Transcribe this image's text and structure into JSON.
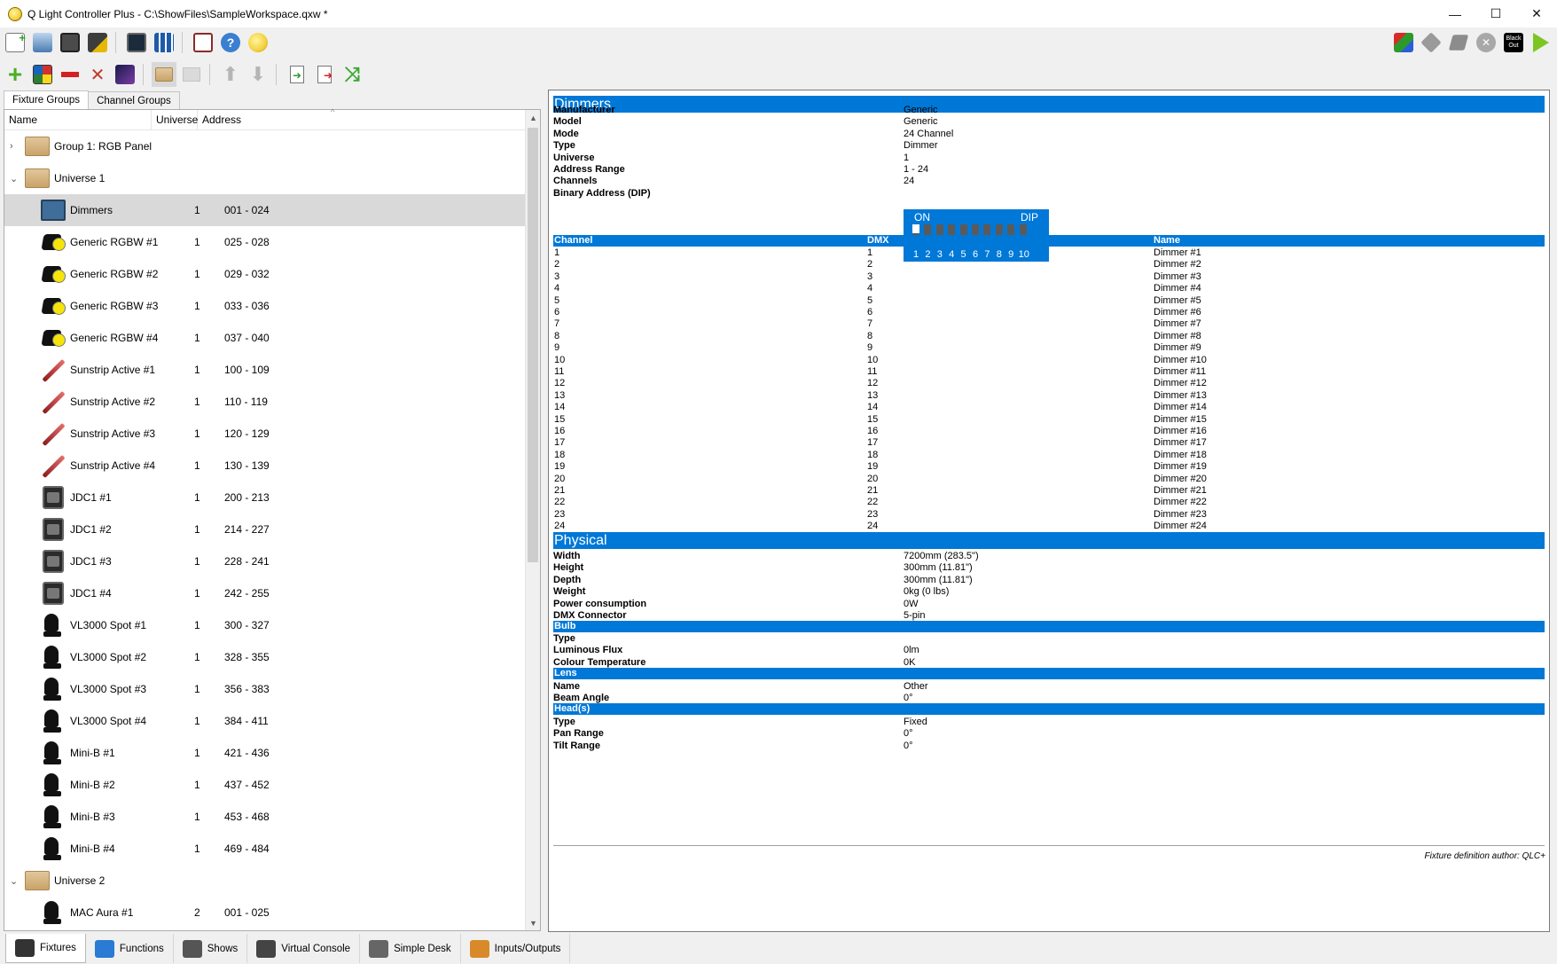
{
  "window": {
    "title": "Q Light Controller Plus - C:\\ShowFiles\\SampleWorkspace.qxw *",
    "minimize": "—",
    "maximize": "☐",
    "close": "✕"
  },
  "toolbar_top": {
    "icons": [
      "new-workspace-icon",
      "open-workspace-icon",
      "save-workspace-icon",
      "save-as-icon",
      "monitor-icon",
      "address-tool-icon",
      "fullscreen-icon",
      "help-icon",
      "about-icon"
    ],
    "right_icons": [
      "live-edit-icon",
      "stop-all-functions-icon",
      "kill-icon",
      "blackout-icon",
      "operate-mode-icon"
    ],
    "blackout_label": "Black Out"
  },
  "toolbar_fixtures": {
    "icons": [
      "add-fixture-icon",
      "add-rgb-panel-icon",
      "remove-fixture-icon",
      "configure-fixture-icon",
      "fade-config-icon",
      "group-fixture-icon",
      "ungroup-fixture-icon",
      "move-up-icon",
      "move-down-icon",
      "import-icon",
      "export-icon",
      "remap-icon"
    ]
  },
  "left_tabs": [
    {
      "label": "Fixture Groups",
      "active": true
    },
    {
      "label": "Channel Groups",
      "active": false
    }
  ],
  "tree": {
    "headers": {
      "name": "Name",
      "universe": "Universe",
      "address": "Address"
    },
    "rows": [
      {
        "type": "group",
        "level": 0,
        "expander": "›",
        "name": "Group 1: RGB Panel",
        "universe": "",
        "address": "",
        "icon": "folder-icon"
      },
      {
        "type": "universe",
        "level": 0,
        "expander": "⌄",
        "name": "Universe 1",
        "universe": "",
        "address": "",
        "icon": "folder-icon"
      },
      {
        "type": "fixture",
        "level": 1,
        "name": "Dimmers",
        "universe": "1",
        "address": "001 - 024",
        "icon": "dimmer-icon",
        "selected": true
      },
      {
        "type": "fixture",
        "level": 1,
        "name": "Generic RGBW #1",
        "universe": "1",
        "address": "025 - 028",
        "icon": "par-icon"
      },
      {
        "type": "fixture",
        "level": 1,
        "name": "Generic RGBW #2",
        "universe": "1",
        "address": "029 - 032",
        "icon": "par-icon"
      },
      {
        "type": "fixture",
        "level": 1,
        "name": "Generic RGBW #3",
        "universe": "1",
        "address": "033 - 036",
        "icon": "par-icon"
      },
      {
        "type": "fixture",
        "level": 1,
        "name": "Generic RGBW #4",
        "universe": "1",
        "address": "037 - 040",
        "icon": "par-icon"
      },
      {
        "type": "fixture",
        "level": 1,
        "name": "Sunstrip Active #1",
        "universe": "1",
        "address": "100 - 109",
        "icon": "strip-icon"
      },
      {
        "type": "fixture",
        "level": 1,
        "name": "Sunstrip Active #2",
        "universe": "1",
        "address": "110 - 119",
        "icon": "strip-icon"
      },
      {
        "type": "fixture",
        "level": 1,
        "name": "Sunstrip Active #3",
        "universe": "1",
        "address": "120 - 129",
        "icon": "strip-icon"
      },
      {
        "type": "fixture",
        "level": 1,
        "name": "Sunstrip Active #4",
        "universe": "1",
        "address": "130 - 139",
        "icon": "strip-icon"
      },
      {
        "type": "fixture",
        "level": 1,
        "name": "JDC1 #1",
        "universe": "1",
        "address": "200 - 213",
        "icon": "strobe-icon"
      },
      {
        "type": "fixture",
        "level": 1,
        "name": "JDC1 #2",
        "universe": "1",
        "address": "214 - 227",
        "icon": "strobe-icon"
      },
      {
        "type": "fixture",
        "level": 1,
        "name": "JDC1 #3",
        "universe": "1",
        "address": "228 - 241",
        "icon": "strobe-icon"
      },
      {
        "type": "fixture",
        "level": 1,
        "name": "JDC1 #4",
        "universe": "1",
        "address": "242 - 255",
        "icon": "strobe-icon"
      },
      {
        "type": "fixture",
        "level": 1,
        "name": "VL3000 Spot #1",
        "universe": "1",
        "address": "300 - 327",
        "icon": "moving-head-icon"
      },
      {
        "type": "fixture",
        "level": 1,
        "name": "VL3000 Spot #2",
        "universe": "1",
        "address": "328 - 355",
        "icon": "moving-head-icon"
      },
      {
        "type": "fixture",
        "level": 1,
        "name": "VL3000 Spot #3",
        "universe": "1",
        "address": "356 - 383",
        "icon": "moving-head-icon"
      },
      {
        "type": "fixture",
        "level": 1,
        "name": "VL3000 Spot #4",
        "universe": "1",
        "address": "384 - 411",
        "icon": "moving-head-icon"
      },
      {
        "type": "fixture",
        "level": 1,
        "name": "Mini-B #1",
        "universe": "1",
        "address": "421 - 436",
        "icon": "moving-head-icon"
      },
      {
        "type": "fixture",
        "level": 1,
        "name": "Mini-B #2",
        "universe": "1",
        "address": "437 - 452",
        "icon": "moving-head-icon"
      },
      {
        "type": "fixture",
        "level": 1,
        "name": "Mini-B #3",
        "universe": "1",
        "address": "453 - 468",
        "icon": "moving-head-icon"
      },
      {
        "type": "fixture",
        "level": 1,
        "name": "Mini-B #4",
        "universe": "1",
        "address": "469 - 484",
        "icon": "moving-head-icon"
      },
      {
        "type": "universe",
        "level": 0,
        "expander": "⌄",
        "name": "Universe 2",
        "universe": "",
        "address": "",
        "icon": "folder-icon"
      },
      {
        "type": "fixture",
        "level": 1,
        "name": "MAC Aura #1",
        "universe": "2",
        "address": "001 - 025",
        "icon": "moving-head-icon"
      }
    ]
  },
  "info": {
    "title": "Dimmers",
    "props": [
      {
        "k": "Manufacturer",
        "v": "Generic"
      },
      {
        "k": "Model",
        "v": "Generic"
      },
      {
        "k": "Mode",
        "v": "24 Channel"
      },
      {
        "k": "Type",
        "v": "Dimmer"
      },
      {
        "k": "Universe",
        "v": "1"
      },
      {
        "k": "Address Range",
        "v": "1 - 24"
      },
      {
        "k": "Channels",
        "v": "24"
      },
      {
        "k": "Binary Address (DIP)",
        "v": ""
      }
    ],
    "dip": {
      "on_label": "ON",
      "dip_label": "DIP",
      "switches": [
        1,
        0,
        0,
        0,
        0,
        0,
        0,
        0,
        0,
        0
      ],
      "numbers": [
        "1",
        "2",
        "3",
        "4",
        "5",
        "6",
        "7",
        "8",
        "9",
        "10"
      ]
    },
    "channel_headers": {
      "channel": "Channel",
      "dmx": "DMX",
      "name": "Name"
    },
    "channels": [
      [
        "1",
        "1",
        "Dimmer #1"
      ],
      [
        "2",
        "2",
        "Dimmer #2"
      ],
      [
        "3",
        "3",
        "Dimmer #3"
      ],
      [
        "4",
        "4",
        "Dimmer #4"
      ],
      [
        "5",
        "5",
        "Dimmer #5"
      ],
      [
        "6",
        "6",
        "Dimmer #6"
      ],
      [
        "7",
        "7",
        "Dimmer #7"
      ],
      [
        "8",
        "8",
        "Dimmer #8"
      ],
      [
        "9",
        "9",
        "Dimmer #9"
      ],
      [
        "10",
        "10",
        "Dimmer #10"
      ],
      [
        "11",
        "11",
        "Dimmer #11"
      ],
      [
        "12",
        "12",
        "Dimmer #12"
      ],
      [
        "13",
        "13",
        "Dimmer #13"
      ],
      [
        "14",
        "14",
        "Dimmer #14"
      ],
      [
        "15",
        "15",
        "Dimmer #15"
      ],
      [
        "16",
        "16",
        "Dimmer #16"
      ],
      [
        "17",
        "17",
        "Dimmer #17"
      ],
      [
        "18",
        "18",
        "Dimmer #18"
      ],
      [
        "19",
        "19",
        "Dimmer #19"
      ],
      [
        "20",
        "20",
        "Dimmer #20"
      ],
      [
        "21",
        "21",
        "Dimmer #21"
      ],
      [
        "22",
        "22",
        "Dimmer #22"
      ],
      [
        "23",
        "23",
        "Dimmer #23"
      ],
      [
        "24",
        "24",
        "Dimmer #24"
      ]
    ],
    "physical_title": "Physical",
    "physical": [
      {
        "k": "Width",
        "v": "7200mm (283.5\")"
      },
      {
        "k": "Height",
        "v": "300mm (11.81\")"
      },
      {
        "k": "Depth",
        "v": "300mm (11.81\")"
      },
      {
        "k": "Weight",
        "v": "0kg (0 lbs)"
      },
      {
        "k": "Power consumption",
        "v": "0W"
      },
      {
        "k": "DMX Connector",
        "v": "5-pin"
      }
    ],
    "bulb_title": "Bulb",
    "bulb": [
      {
        "k": "Type",
        "v": ""
      },
      {
        "k": "Luminous Flux",
        "v": "0lm"
      },
      {
        "k": "Colour Temperature",
        "v": "0K"
      }
    ],
    "lens_title": "Lens",
    "lens": [
      {
        "k": "Name",
        "v": "Other"
      },
      {
        "k": "Beam Angle",
        "v": "0°"
      }
    ],
    "heads_title": "Head(s)",
    "heads": [
      {
        "k": "Type",
        "v": "Fixed"
      },
      {
        "k": "Pan Range",
        "v": "0°"
      },
      {
        "k": "Tilt Range",
        "v": "0°"
      }
    ],
    "author": "Fixture definition author: QLC+"
  },
  "bottom_tabs": [
    {
      "label": "Fixtures",
      "icon": "fixtures-tab-icon",
      "active": true
    },
    {
      "label": "Functions",
      "icon": "functions-tab-icon",
      "active": false
    },
    {
      "label": "Shows",
      "icon": "shows-tab-icon",
      "active": false
    },
    {
      "label": "Virtual Console",
      "icon": "virtual-console-tab-icon",
      "active": false
    },
    {
      "label": "Simple Desk",
      "icon": "simple-desk-tab-icon",
      "active": false
    },
    {
      "label": "Inputs/Outputs",
      "icon": "inputs-outputs-tab-icon",
      "active": false
    }
  ],
  "colors": {
    "accent": "#0078d7",
    "selection": "#d9d9d9"
  }
}
